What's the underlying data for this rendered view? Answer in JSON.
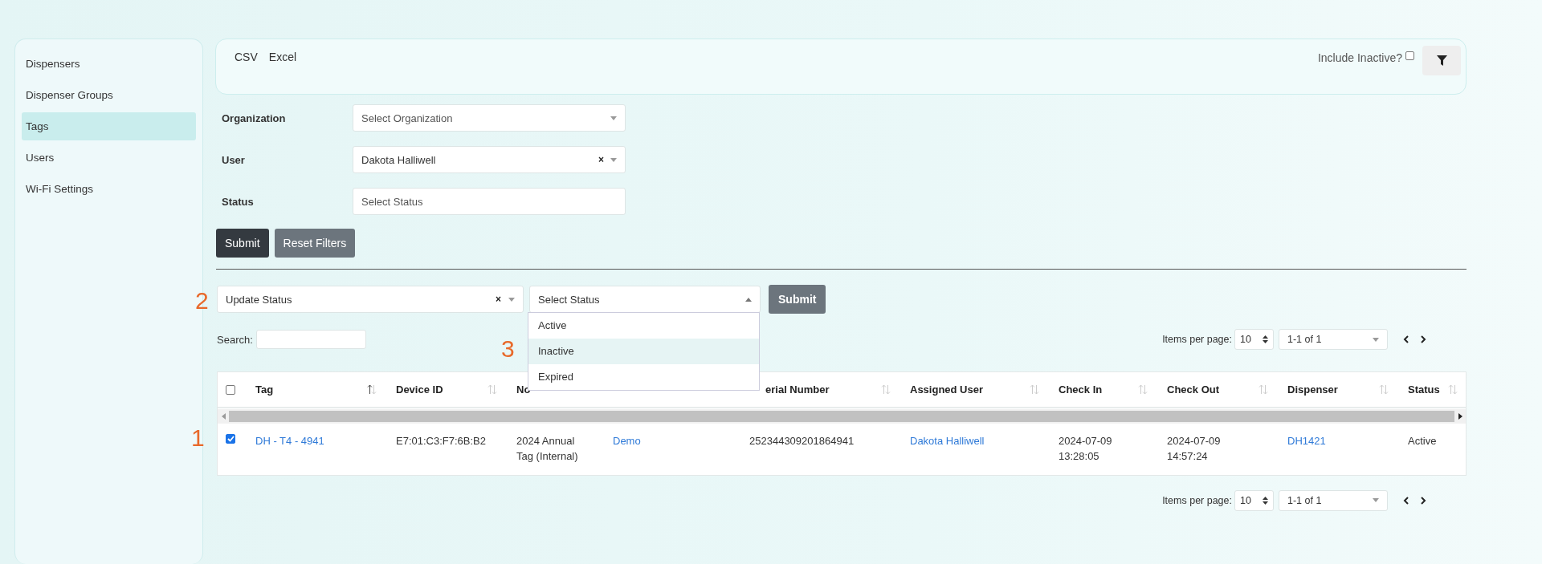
{
  "sidebar": {
    "items": [
      {
        "label": "Dispensers",
        "selected": false
      },
      {
        "label": "Dispenser Groups",
        "selected": false
      },
      {
        "label": "Tags",
        "selected": true
      },
      {
        "label": "Users",
        "selected": false
      },
      {
        "label": "Wi-Fi Settings",
        "selected": false
      }
    ]
  },
  "export_buttons": [
    "CSV",
    "Excel"
  ],
  "include_inactive": {
    "label": "Include Inactive?",
    "checked": false
  },
  "filters": [
    {
      "label": "Organization",
      "placeholder": "Select Organization",
      "dropdown": true
    },
    {
      "label": "User",
      "value": "Dakota Halliwell",
      "clear": "×",
      "dropdown": true
    },
    {
      "label": "Status",
      "placeholder": "Select Status",
      "dropdown": false
    }
  ],
  "filter_buttons": [
    {
      "label": "Submit",
      "kind": "dark"
    },
    {
      "label": "Reset Filters",
      "kind": "secondary"
    }
  ],
  "bulk_action": {
    "value": "Update Status",
    "clear": "×",
    "status_placeholder": "Select Status",
    "expanded": true,
    "submit": "Submit",
    "options": [
      {
        "label": "Active",
        "selected": false
      },
      {
        "label": "Inactive",
        "selected": true
      },
      {
        "label": "Expired",
        "selected": false
      }
    ]
  },
  "search": {
    "label": "Search:"
  },
  "pagination_top": {
    "label": "Items per page:",
    "per_page": "10",
    "range": "1-1 of 1"
  },
  "table": {
    "select_all": {
      "checked": false
    },
    "columns": [
      {
        "label": "Tag",
        "sorted": true
      },
      {
        "label": "Device ID",
        "sorted": false
      },
      {
        "label": "No"
      },
      {},
      {
        "label": "erial Number",
        "sorted": false
      },
      {
        "label": "Assigned User",
        "sorted": false
      },
      {
        "label": "Check In",
        "sorted": false
      },
      {
        "label": "Check Out",
        "sorted": false
      },
      {
        "label": "Dispenser",
        "sorted": false
      },
      {
        "label": "Status",
        "sorted": false
      }
    ],
    "rows": [
      {
        "selected": true,
        "cells": [
          {
            "text": "DH - T4 - 4941",
            "kind": "link"
          },
          {
            "text": "E7:01:C3:F7:6B:B2",
            "kind": "text"
          },
          {
            "text": "2024 Annual Tag (Internal)",
            "kind": "text"
          },
          {
            "text": "Demo",
            "kind": "link"
          },
          {
            "text": "252344309201864941",
            "kind": "text"
          },
          {
            "text": "Dakota Halliwell",
            "kind": "link"
          },
          {
            "text": "2024-07-09 13:28:05",
            "kind": "text"
          },
          {
            "text": "2024-07-09 14:57:24",
            "kind": "text"
          },
          {
            "text": "DH1421",
            "kind": "link"
          },
          {
            "text": "Active",
            "kind": "text"
          }
        ]
      }
    ]
  },
  "pagination_bottom": {
    "label": "Items per page:",
    "per_page": "10",
    "range": "1-1 of 1"
  },
  "annotations": [
    "1",
    "2",
    "3"
  ]
}
